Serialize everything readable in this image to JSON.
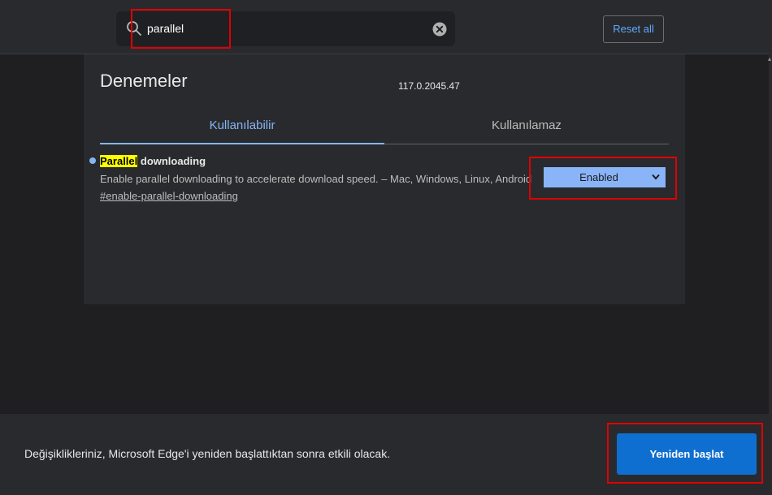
{
  "header": {
    "search": {
      "value": "parallel",
      "search_icon": "search-icon",
      "clear_icon": "clear-icon"
    },
    "reset_all_label": "Reset all"
  },
  "page": {
    "title": "Denemeler",
    "version": "117.0.2045.47"
  },
  "tabs": [
    {
      "label": "Kullanılabilir",
      "active": true
    },
    {
      "label": "Kullanılamaz",
      "active": false
    }
  ],
  "experiment": {
    "title_highlight": "Parallel",
    "title_rest": " downloading",
    "description": "Enable parallel downloading to accelerate download speed. – Mac, Windows, Linux, Android",
    "link": "#enable-parallel-downloading",
    "selected_value": "Enabled"
  },
  "footer": {
    "message": "Değişiklikleriniz, Microsoft Edge'i yeniden başlattıktan sonra etkili olacak.",
    "relaunch_label": "Yeniden başlat"
  },
  "colors": {
    "accent": "#86b5f5",
    "primary_button": "#0f6fd0",
    "highlight": "#ffff00",
    "annotation_red": "#e00000"
  }
}
